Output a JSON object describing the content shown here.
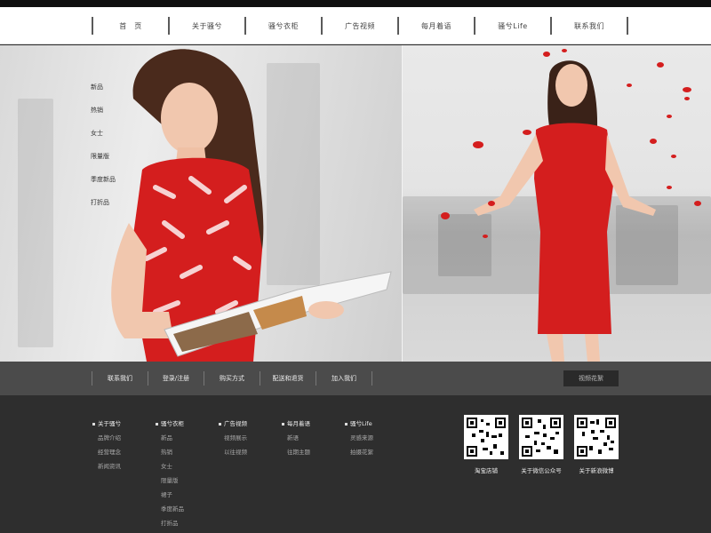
{
  "nav": {
    "items": [
      "首　页",
      "关于骚兮",
      "骚兮衣柜",
      "广告视频",
      "每月着语",
      "骚兮Life",
      "联系我们"
    ]
  },
  "side_menu": {
    "items": [
      "新品",
      "热销",
      "女士",
      "限量版",
      "季度新品",
      "打折品"
    ]
  },
  "subnav": {
    "items": [
      "联系我们",
      "登录/注册",
      "购买方式",
      "配送和退货",
      "加入我们"
    ],
    "button_label": "视频花絮"
  },
  "footer": {
    "columns": [
      {
        "title": "关于骚兮",
        "links": [
          "品牌介绍",
          "经营理念",
          "新闻资讯"
        ]
      },
      {
        "title": "骚兮衣柜",
        "links": [
          "新品",
          "热销",
          "女士",
          "限量版",
          "裙子",
          "季度新品",
          "打折品"
        ]
      },
      {
        "title": "广告视频",
        "links": [
          "视频展示",
          "以往视频"
        ]
      },
      {
        "title": "每月着语",
        "links": [
          "新语",
          "往期主题"
        ]
      },
      {
        "title": "骚兮Life",
        "links": [
          "灵感来源",
          "拍摄花絮"
        ]
      }
    ],
    "qr_codes": [
      {
        "caption": "淘宝店铺"
      },
      {
        "caption": "关于微信公众号"
      },
      {
        "caption": "关于新浪微博"
      }
    ]
  },
  "colors": {
    "nav_bg": "#ffffff",
    "subnav_bg": "#4b4b4b",
    "footer_bg": "#2e2e2e",
    "dress_red": "#d41e1e"
  }
}
